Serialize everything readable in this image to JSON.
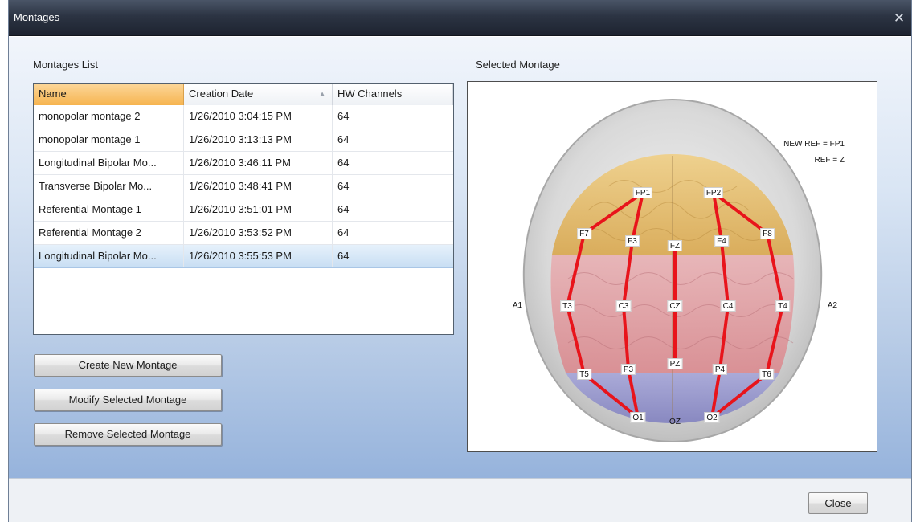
{
  "window": {
    "title": "Montages"
  },
  "list": {
    "label": "Montages List",
    "columns": [
      "Name",
      "Creation Date",
      "HW Channels"
    ],
    "rows": [
      {
        "name": "monopolar montage 2",
        "date": "1/26/2010 3:04:15 PM",
        "channels": "64"
      },
      {
        "name": "monopolar montage 1",
        "date": "1/26/2010 3:13:13 PM",
        "channels": "64"
      },
      {
        "name": "Longitudinal Bipolar Mo...",
        "date": "1/26/2010 3:46:11 PM",
        "channels": "64"
      },
      {
        "name": "Transverse Bipolar Mo...",
        "date": "1/26/2010 3:48:41 PM",
        "channels": "64"
      },
      {
        "name": "Referential Montage 1",
        "date": "1/26/2010 3:51:01 PM",
        "channels": "64"
      },
      {
        "name": "Referential Montage 2",
        "date": "1/26/2010 3:53:52 PM",
        "channels": "64"
      },
      {
        "name": "Longitudinal Bipolar Mo...",
        "date": "1/26/2010 3:55:53 PM",
        "channels": "64"
      }
    ],
    "selected_row": 6,
    "sort_indicator": "▲"
  },
  "buttons": {
    "create": "Create New Montage",
    "modify": "Modify Selected Montage",
    "remove": "Remove Selected Montage",
    "close": "Close"
  },
  "montage": {
    "label": "Selected Montage",
    "new_ref": "NEW REF = FP1",
    "ref": "REF = Z",
    "electrodes": {
      "fp1": "FP1",
      "fp2": "FP2",
      "f7": "F7",
      "f3": "F3",
      "fz": "FZ",
      "f4": "F4",
      "f8": "F8",
      "a1": "A1",
      "t3": "T3",
      "c3": "C3",
      "cz": "CZ",
      "c4": "C4",
      "t4": "T4",
      "a2": "A2",
      "t5": "T5",
      "p3": "P3",
      "pz": "PZ",
      "p4": "P4",
      "t6": "T6",
      "o1": "O1",
      "oz": "OZ",
      "o2": "O2"
    }
  },
  "colors": {
    "accent_header": "#f6b44f",
    "link_line": "#e8141b",
    "selection": "#c8def3"
  }
}
